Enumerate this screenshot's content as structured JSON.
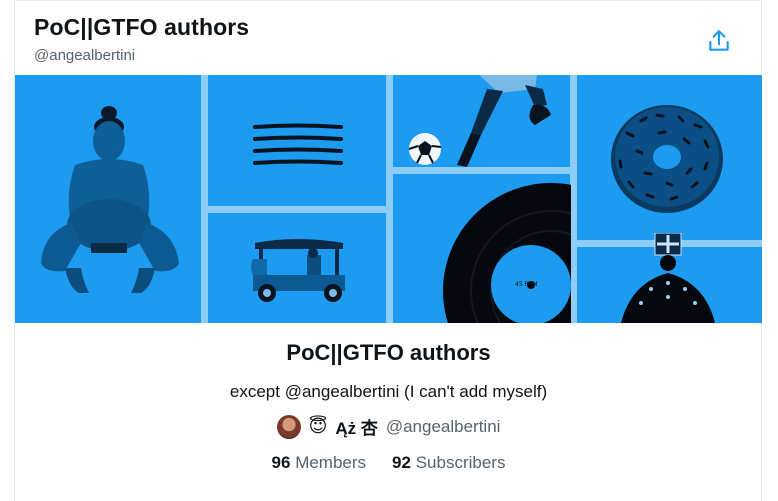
{
  "header": {
    "title": "PoC||GTFO authors",
    "handle": "@angealbertini"
  },
  "colors": {
    "accent": "#1d9bf0",
    "text": "#0f1419",
    "muted": "#536471"
  },
  "list": {
    "name": "PoC||GTFO authors",
    "description": "except @angealbertini (I can't add myself)",
    "owner": {
      "emoji": "😇",
      "name": "Ąż 杏",
      "handle": "@angealbertini"
    },
    "members_count": "96",
    "members_label": "Members",
    "subscribers_count": "92",
    "subscribers_label": "Subscribers"
  },
  "icons": {
    "share": "share-icon"
  }
}
